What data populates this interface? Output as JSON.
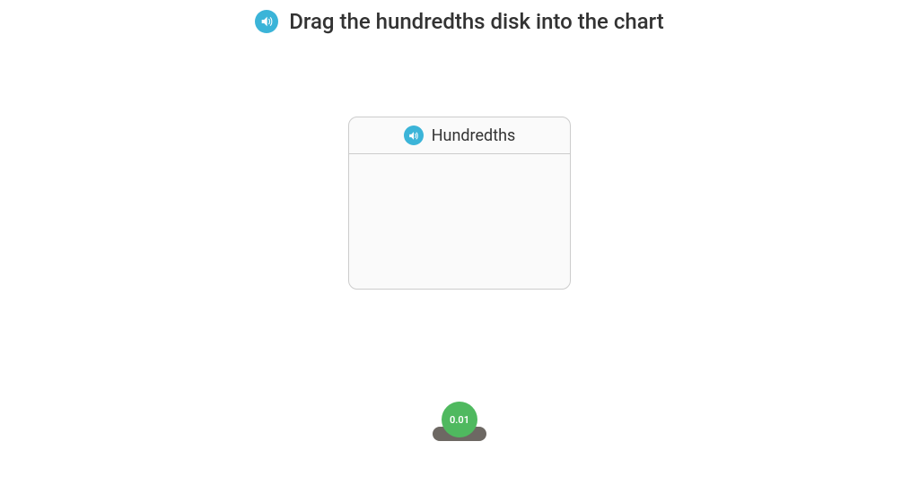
{
  "instruction": "Drag the hundredths disk into the chart",
  "chart": {
    "header": "Hundredths"
  },
  "disk": {
    "label": "0.01"
  }
}
